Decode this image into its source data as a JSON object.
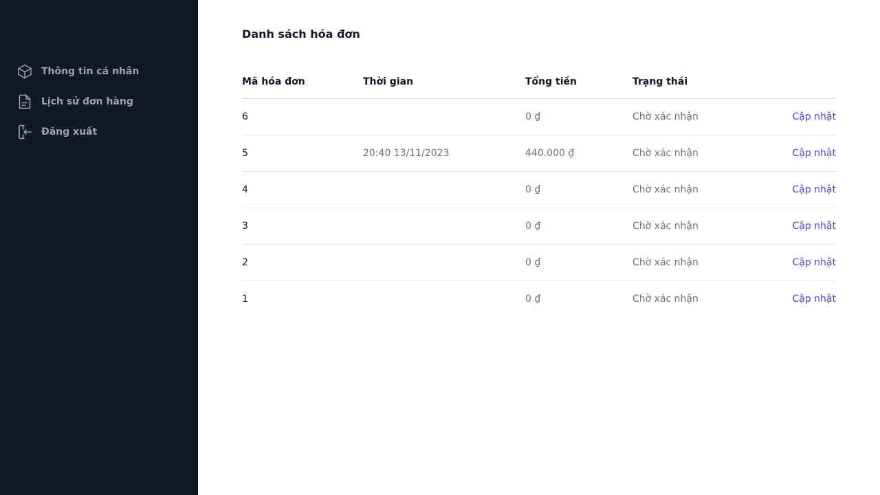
{
  "sidebar": {
    "items": [
      {
        "label": "Thông tin cá nhân",
        "icon": "cube-icon"
      },
      {
        "label": "Lịch sử đơn hàng",
        "icon": "document-icon"
      },
      {
        "label": "Đăng xuất",
        "icon": "logout-icon"
      }
    ]
  },
  "main": {
    "title": "Danh sách hóa đơn",
    "table": {
      "headers": [
        "Mã hóa đơn",
        "Thời gian",
        "Tổng tiền",
        "Trạng thái"
      ],
      "rows": [
        {
          "id": "6",
          "time": "",
          "total": "0 ₫",
          "status": "Chờ xác nhận",
          "action": "Cập nhật"
        },
        {
          "id": "5",
          "time": "20:40 13/11/2023",
          "total": "440.000 ₫",
          "status": "Chờ xác nhận",
          "action": "Cập nhật"
        },
        {
          "id": "4",
          "time": "",
          "total": "0 ₫",
          "status": "Chờ xác nhận",
          "action": "Cập nhật"
        },
        {
          "id": "3",
          "time": "",
          "total": "0 ₫",
          "status": "Chờ xác nhận",
          "action": "Cập nhật"
        },
        {
          "id": "2",
          "time": "",
          "total": "0 ₫",
          "status": "Chờ xác nhận",
          "action": "Cập nhật"
        },
        {
          "id": "1",
          "time": "",
          "total": "0 ₫",
          "status": "Chờ xác nhận",
          "action": "Cập nhật"
        }
      ]
    }
  },
  "colors": {
    "sidebar_bg": "#111827",
    "sidebar_text": "#9ca3af",
    "link": "#4f46e5"
  }
}
